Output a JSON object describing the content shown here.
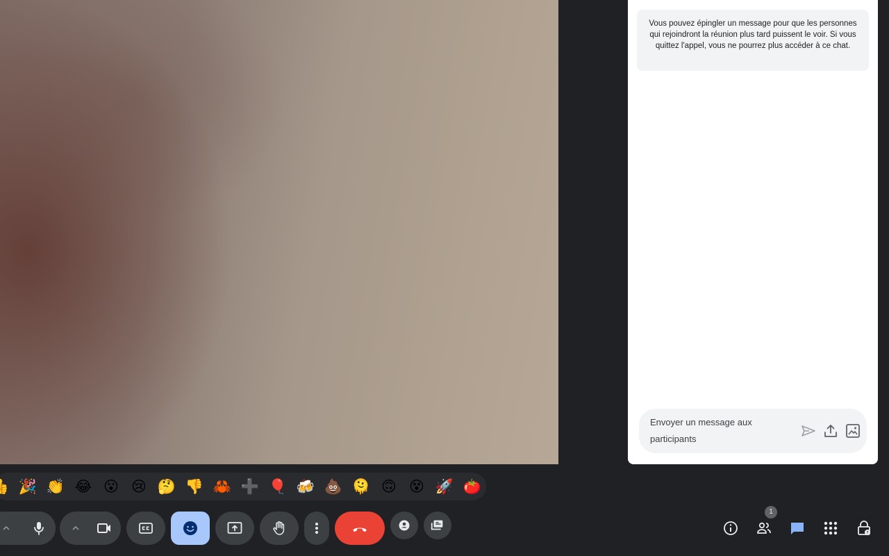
{
  "chat": {
    "pin_info": "Vous pouvez épingler un message pour que les personnes qui rejoindront la réunion plus tard puissent le voir. Si vous quittez l'appel, vous ne pourrez plus accéder à ce chat.",
    "compose_placeholder": "Envoyer un message aux participants",
    "icons": [
      "send-icon",
      "upload-icon",
      "image-icon"
    ]
  },
  "reactions": [
    {
      "name": "thumbs-up",
      "glyph": "👍"
    },
    {
      "name": "party-popper",
      "glyph": "🎉"
    },
    {
      "name": "clapping",
      "glyph": "👏"
    },
    {
      "name": "laughing",
      "glyph": "😂"
    },
    {
      "name": "surprised",
      "glyph": "😮"
    },
    {
      "name": "crying",
      "glyph": "😢"
    },
    {
      "name": "thinking",
      "glyph": "🤔"
    },
    {
      "name": "thumbs-down",
      "glyph": "👎"
    },
    {
      "name": "crab",
      "glyph": "🦀"
    },
    {
      "name": "plus",
      "glyph": "➕"
    },
    {
      "name": "balloon",
      "glyph": "🎈"
    },
    {
      "name": "beers",
      "glyph": "🍻"
    },
    {
      "name": "poop",
      "glyph": "💩"
    },
    {
      "name": "melting-face",
      "glyph": "🫠"
    },
    {
      "name": "upside-down-face",
      "glyph": "🙃"
    },
    {
      "name": "dizzy-face",
      "glyph": "😵"
    },
    {
      "name": "rocket",
      "glyph": "🚀"
    },
    {
      "name": "tomato",
      "glyph": "🍅"
    }
  ],
  "controls": {
    "participants_count": "1"
  },
  "colors": {
    "background": "#202124",
    "control_bg": "#3c4043",
    "active_bg": "#a8c7fa",
    "end_call": "#ea4335",
    "chat_active": "#8ab4f8"
  }
}
